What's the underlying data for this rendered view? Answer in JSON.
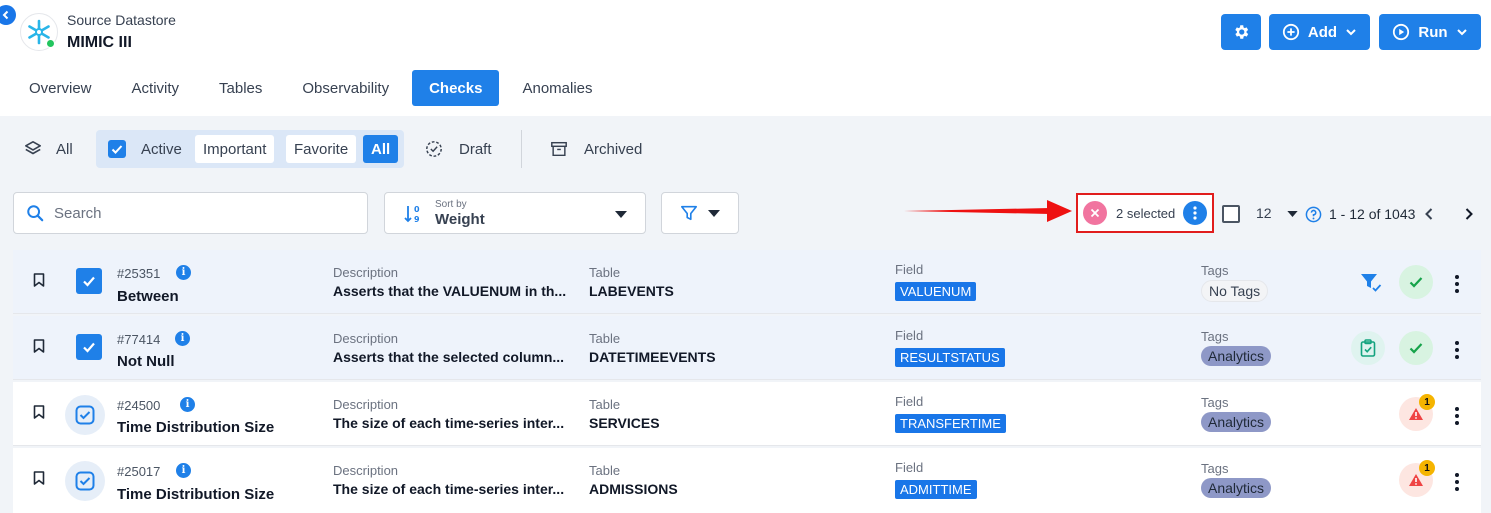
{
  "header": {
    "datastore_label": "Source Datastore",
    "datastore_name": "MIMIC III",
    "add_label": "Add",
    "run_label": "Run"
  },
  "tabs": [
    {
      "label": "Overview"
    },
    {
      "label": "Activity"
    },
    {
      "label": "Tables"
    },
    {
      "label": "Observability"
    },
    {
      "label": "Checks",
      "active": true
    },
    {
      "label": "Anomalies"
    }
  ],
  "status_filters": {
    "all": "All",
    "active": "Active",
    "important": "Important",
    "favorite": "Favorite",
    "all_sub": "All",
    "draft": "Draft",
    "archived": "Archived"
  },
  "search": {
    "placeholder": "Search",
    "value": ""
  },
  "sort": {
    "label": "Sort by",
    "value": "Weight"
  },
  "selection": {
    "text": "2 selected"
  },
  "pagination": {
    "page_size": "12",
    "range": "1 - 12 of 1043"
  },
  "columns": {
    "description": "Description",
    "table": "Table",
    "field": "Field",
    "tags": "Tags"
  },
  "rows": [
    {
      "id": "#25351",
      "name": "Between",
      "description": "Asserts that the VALUENUM in th...",
      "table": "LABEVENTS",
      "field": "VALUENUM",
      "tag": "No Tags",
      "selected": true,
      "status": "ok"
    },
    {
      "id": "#77414",
      "name": "Not Null",
      "description": "Asserts that the selected column...",
      "table": "DATETIMEEVENTS",
      "field": "RESULTSTATUS",
      "tag": "Analytics",
      "selected": true,
      "status": "ok"
    },
    {
      "id": "#24500",
      "name": "Time Distribution Size",
      "description": "The size of each time-series inter...",
      "table": "SERVICES",
      "field": "TRANSFERTIME",
      "tag": "Analytics",
      "selected": false,
      "status": "warning",
      "anomalies": "1"
    },
    {
      "id": "#25017",
      "name": "Time Distribution Size",
      "description": "The size of each time-series inter...",
      "table": "ADMISSIONS",
      "field": "ADMITTIME",
      "tag": "Analytics",
      "selected": false,
      "status": "warning",
      "anomalies": "1"
    }
  ],
  "colors": {
    "primary": "#1f80e8",
    "success": "#16a34a",
    "warning": "#ef4444",
    "badge": "#f5b400"
  }
}
